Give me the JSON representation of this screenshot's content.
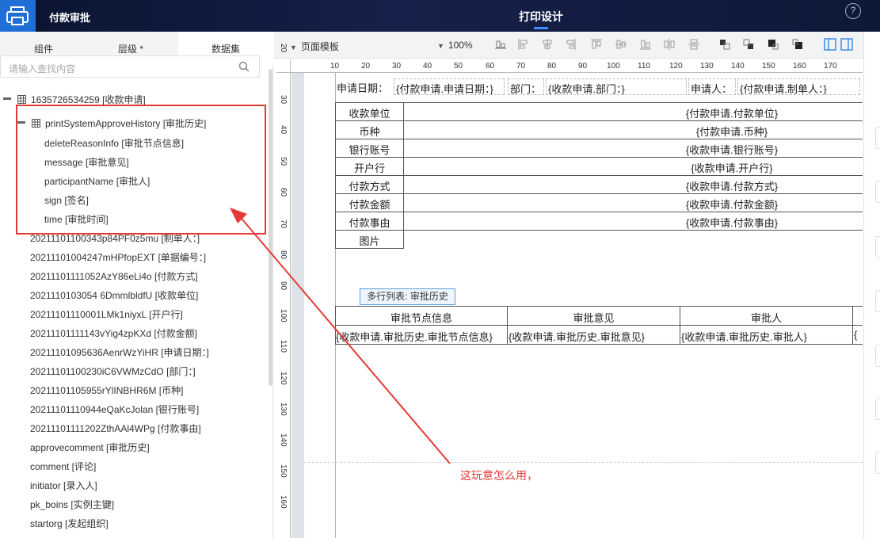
{
  "header": {
    "app_title": "付款审批",
    "center_title": "打印设计",
    "help_icon": "?"
  },
  "left_panel": {
    "tabs": [
      {
        "label": "组件"
      },
      {
        "label": "层级 *"
      },
      {
        "label": "数据集"
      }
    ],
    "search_placeholder": "请输入查找内容",
    "tree": {
      "root": "1635726534259 [收款申请]",
      "group": "printSystemApproveHistory [审批历史]",
      "group_children": [
        "deleteReasonInfo [审批节点信息]",
        "message [审批意见]",
        "participantName [审批人]",
        "sign [签名]",
        "time [审批时间]"
      ],
      "fields": [
        "20211101100343p84PF0z5mu [制单人：]",
        "20211101004247mHPfopEXT [单据编号：]",
        "20211101111052AzY86eLi4o [付款方式]",
        "2021110103054 6DmmlbldfU [收款单位]",
        "20211101110001LMk1niyxL [开户行]",
        "20211101111143vYig4zpKXd [付款金额]",
        "20211101095636AenrWzYiHR [申请日期：]",
        "20211101100230iC6VWMzCdO [部门：]",
        "20211101105955rYlINBHR6M [币种]",
        "20211101110944eQaKcJolan [银行账号]",
        "20211101111202ZthAAl4WPg [付款事由]",
        "approvecomment [审批历史]",
        "comment [评论]",
        "initiator [录入人]",
        "pk_boins [实例主键]",
        "startorg [发起组织]"
      ]
    }
  },
  "toolbar": {
    "template_label": "页面模板",
    "zoom_label": "100%"
  },
  "ruler": {
    "top_ticks": [
      "10",
      "20",
      "30",
      "40",
      "50",
      "60",
      "70",
      "80",
      "90",
      "100",
      "110",
      "120",
      "130",
      "140",
      "150",
      "160",
      "170"
    ],
    "left_ticks": [
      "20",
      "30",
      "40",
      "50",
      "60",
      "70",
      "80",
      "90",
      "100",
      "110",
      "120",
      "130",
      "140",
      "150",
      "160"
    ]
  },
  "form": {
    "header_fields": [
      {
        "label": "申请日期：",
        "value": "{付款申请.申请日期：}"
      },
      {
        "label": "部门：",
        "value": "{收款申请.部门：}"
      },
      {
        "label": "申请人：",
        "value": "{付款申请.制单人：}"
      }
    ],
    "table_rows": [
      {
        "label": "收款单位",
        "value": "{付款申请.付款单位}"
      },
      {
        "label": "币种",
        "value": "{付款申请.币种}"
      },
      {
        "label": "银行账号",
        "value": "{收款申请.银行账号}"
      },
      {
        "label": "开户行",
        "value": "{收款申请.开户行}"
      },
      {
        "label": "付款方式",
        "value": "{收款申请.付款方式}"
      },
      {
        "label": "付款金额",
        "value": "{收款申请.付款金额}"
      },
      {
        "label": "付款事由",
        "value": "{收款申请.付款事由}"
      },
      {
        "label": "图片",
        "value": ""
      }
    ],
    "list_tag": "多行列表: 审批历史",
    "history_headers": [
      "审批节点信息",
      "审批意见",
      "审批人"
    ],
    "history_values": [
      "{收款申请.审批历史.审批节点信息}",
      "{收款申请.审批历史.审批意见}",
      "{收款申请.审批历史.审批人}",
      "{"
    ]
  },
  "annotation": "这玩意怎么用，",
  "colors": {
    "header_bg": "#0e1838",
    "accent": "#1f6fd6",
    "annotation_red": "#e53935"
  }
}
